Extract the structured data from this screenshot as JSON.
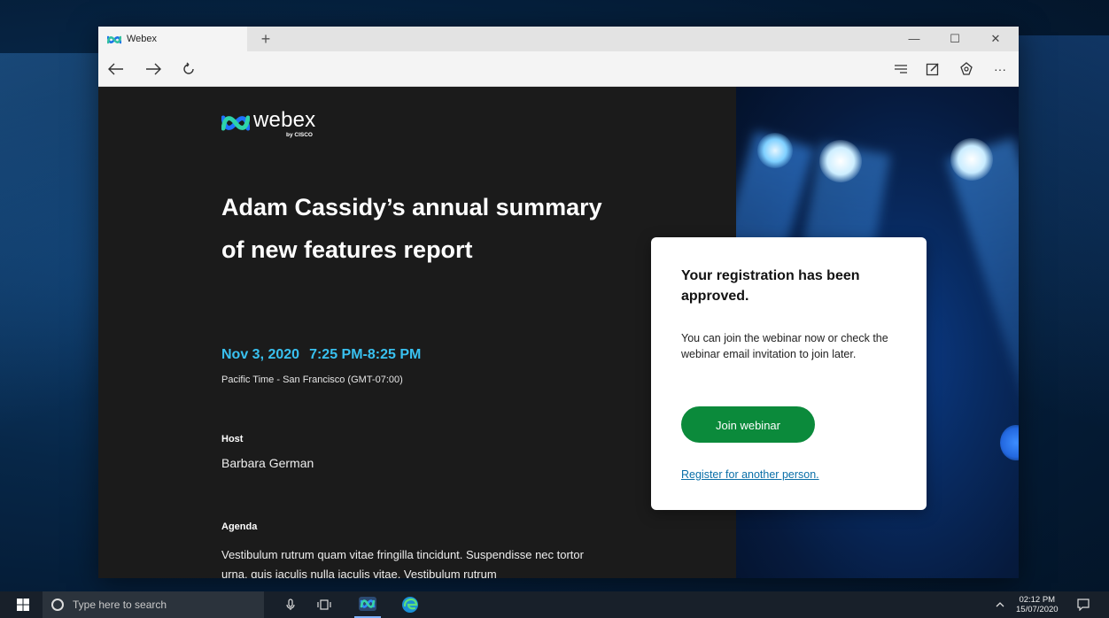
{
  "browser": {
    "tab_title": "Webex",
    "new_tab_label": "+",
    "window_controls": {
      "minimize": "—",
      "maximize": "☐",
      "close": "✕"
    },
    "toolbar_more": "···"
  },
  "page": {
    "logo": {
      "wordmark": "webex",
      "byline": "by CISCO"
    },
    "title": "Adam Cassidy’s annual summary of new features report",
    "date": "Nov 3, 2020",
    "time_range": "7:25 PM-8:25 PM",
    "timezone": "Pacific Time - San Francisco (GMT-07:00)",
    "host_label": "Host",
    "host_name": "Barbara German",
    "agenda_label": "Agenda",
    "agenda_text": "Vestibulum rutrum quam vitae fringilla tincidunt. Suspendisse nec tortor urna. quis iaculis nulla iaculis vitae. Vestibulum rutrum"
  },
  "card": {
    "title": "Your registration has been approved.",
    "body": "You can join the webinar now or check the webinar email invitation to join later.",
    "join_button": "Join webinar",
    "register_link": "Register for another person."
  },
  "taskbar": {
    "search_placeholder": "Type here to search",
    "time": "02:12 PM",
    "date": "15/07/2020"
  },
  "colors": {
    "accent_time": "#39c1f0",
    "join_button": "#0b8a3b",
    "link": "#0a6fa8"
  }
}
